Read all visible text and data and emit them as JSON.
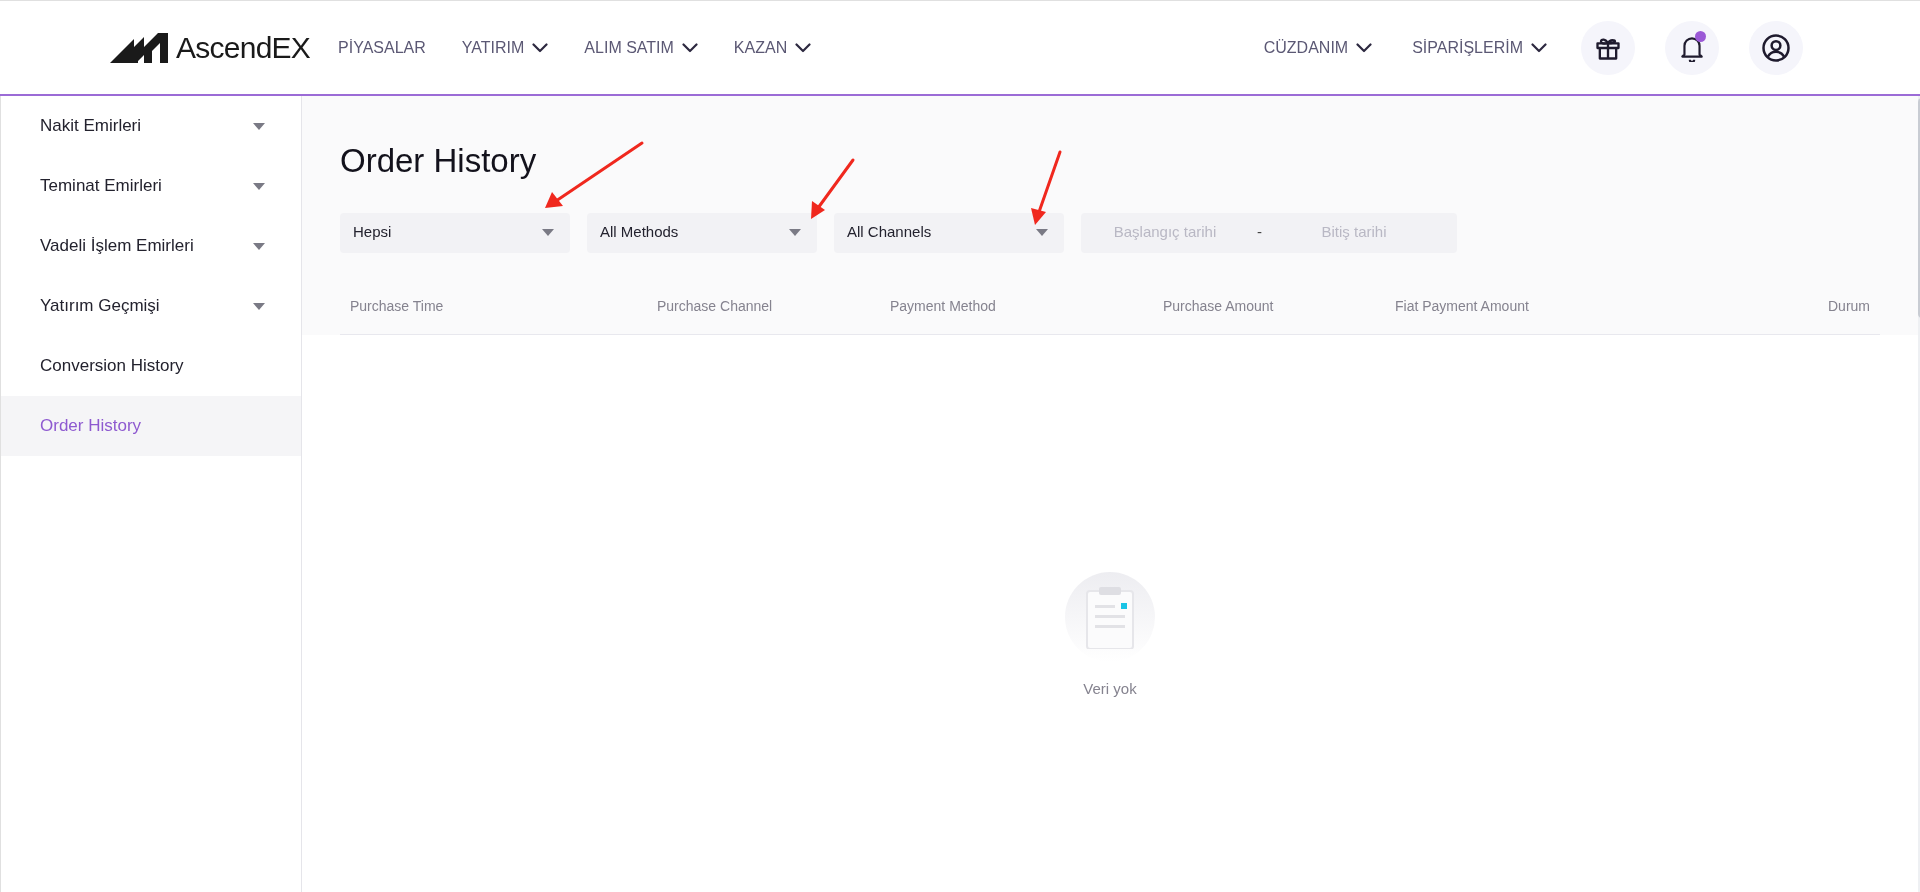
{
  "header": {
    "logo": "AscendEX",
    "nav_left": [
      {
        "label": "PİYASALAR",
        "kind": "link"
      },
      {
        "label": "YATIRIM",
        "kind": "dropdown"
      },
      {
        "label": "ALIM SATIM",
        "kind": "dropdown"
      },
      {
        "label": "KAZAN",
        "kind": "dropdown"
      }
    ],
    "nav_right": [
      {
        "label": "CÜZDANIM",
        "kind": "dropdown"
      },
      {
        "label": "SİPARİŞLERİM",
        "kind": "dropdown"
      }
    ],
    "notifications_unread": true
  },
  "sidebar": {
    "items": [
      {
        "label": "Nakit Emirleri",
        "kind": "group",
        "selected": false
      },
      {
        "label": "Teminat Emirleri",
        "kind": "group",
        "selected": false
      },
      {
        "label": "Vadeli İşlem Emirleri",
        "kind": "group",
        "selected": false
      },
      {
        "label": "Yatırım Geçmişi",
        "kind": "group",
        "selected": false
      },
      {
        "label": "Conversion History",
        "kind": "link",
        "selected": false
      },
      {
        "label": "Order History",
        "kind": "link",
        "selected": true
      }
    ]
  },
  "main": {
    "title": "Order History",
    "filters": [
      {
        "value": "Hepsi"
      },
      {
        "value": "All Methods"
      },
      {
        "value": "All Channels"
      }
    ],
    "date_range": {
      "start_placeholder": "Başlangıç tarihi",
      "separator": "-",
      "end_placeholder": "Bitiş tarihi"
    },
    "table": {
      "columns": [
        "Purchase Time",
        "Purchase Channel",
        "Payment Method",
        "Purchase Amount",
        "Fiat Payment Amount",
        "Durum"
      ]
    },
    "empty_state": {
      "text": "Veri yok"
    }
  }
}
